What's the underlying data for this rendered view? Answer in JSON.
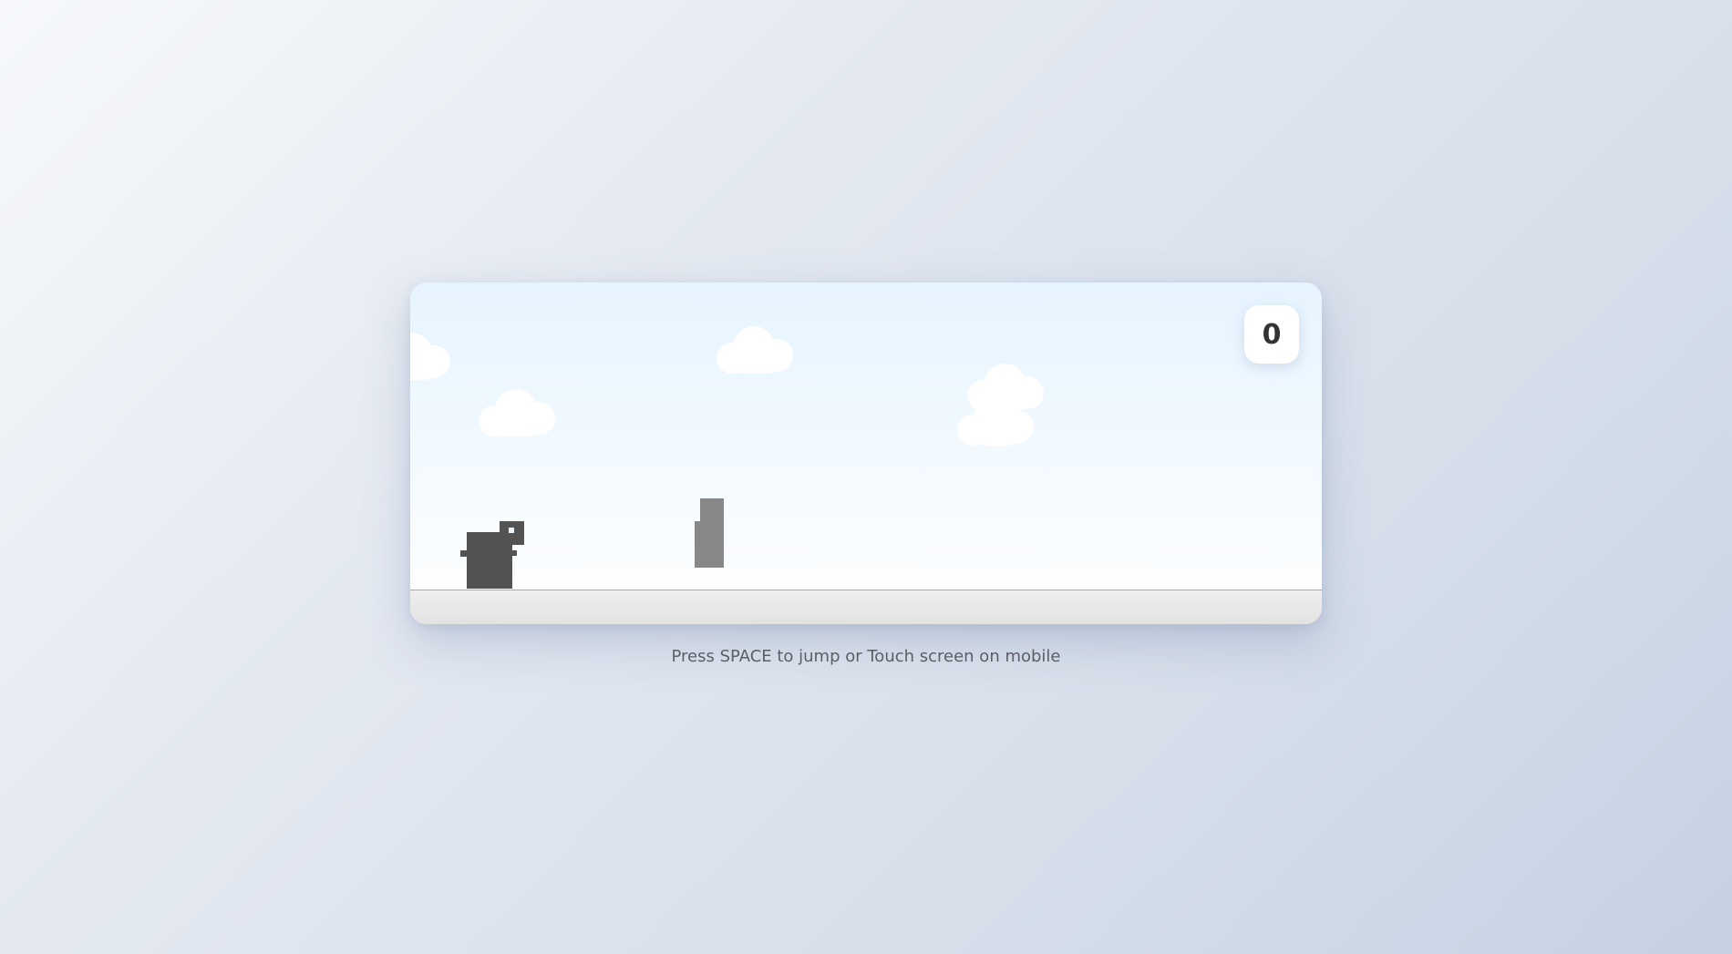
{
  "game": {
    "score": "0",
    "instructions": "Press SPACE to jump or Touch screen on mobile"
  },
  "icons": {
    "player": "dino-icon",
    "obstacle": "cactus-icon",
    "clouds": "cloud-icon"
  },
  "colors": {
    "player": "#535353",
    "obstacle": "#888888",
    "sky_top": "#e6f4ff",
    "ground": "#e2e2e2"
  }
}
